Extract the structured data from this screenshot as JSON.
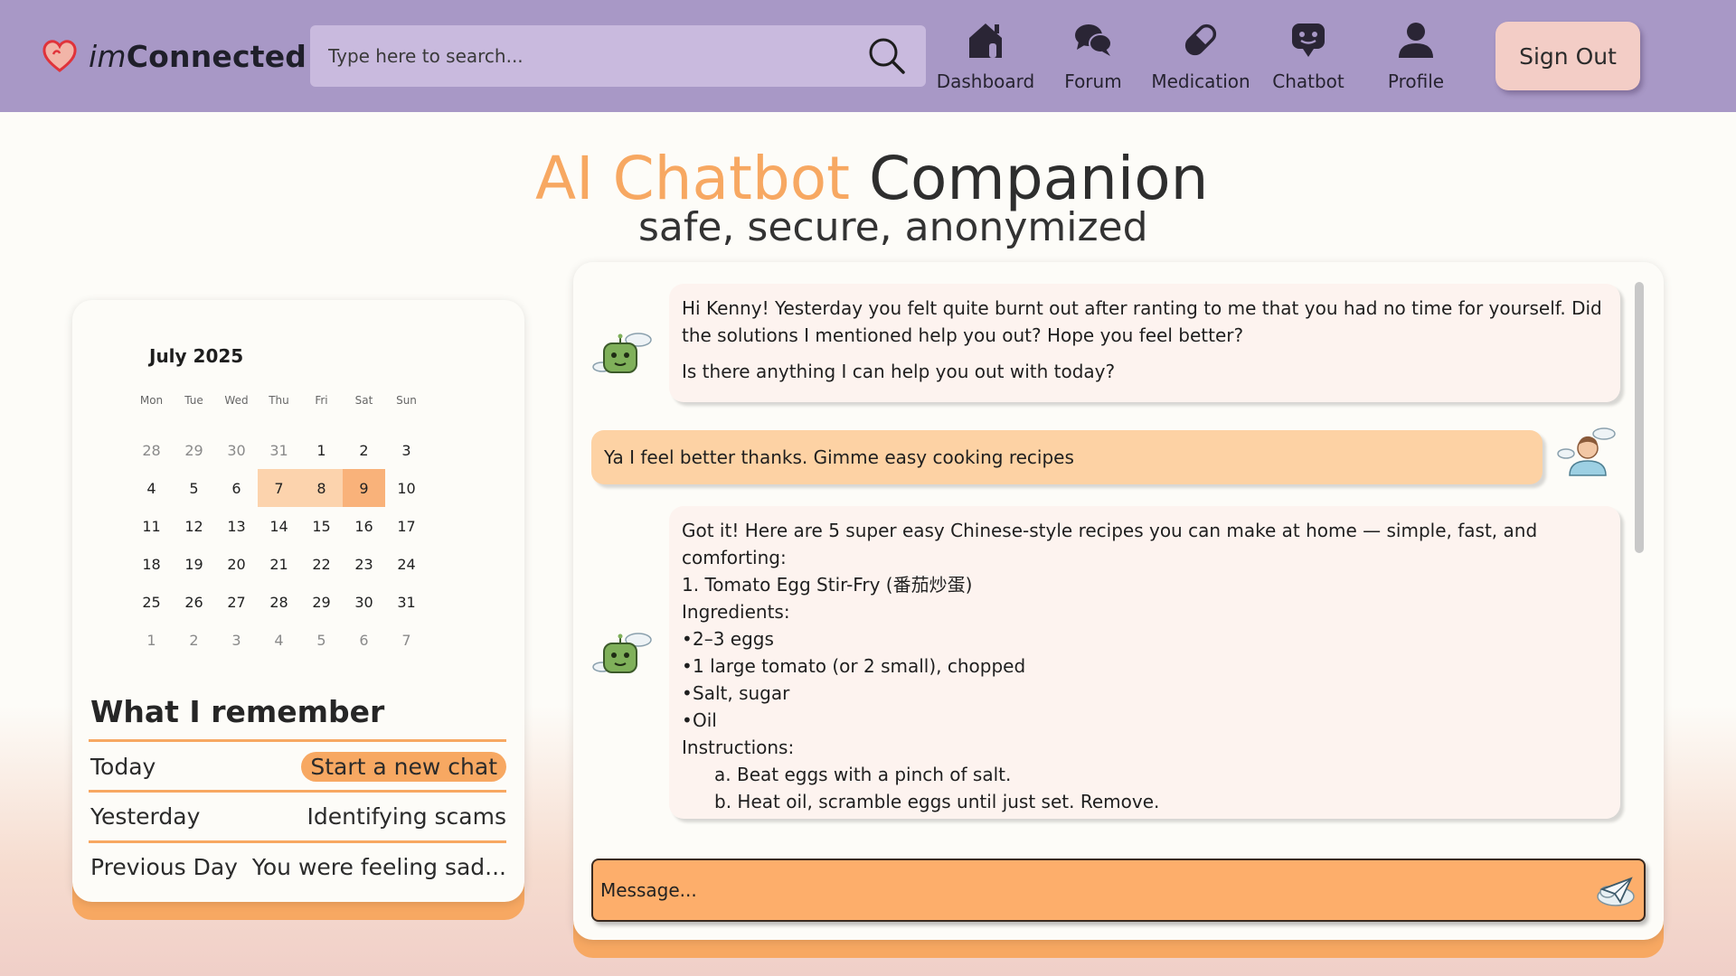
{
  "app": {
    "logo_im": "im",
    "logo_connected": "Connected"
  },
  "search": {
    "placeholder": "Type here to search..."
  },
  "nav": {
    "dashboard": "Dashboard",
    "forum": "Forum",
    "medication": "Medication",
    "chatbot": "Chatbot",
    "profile": "Profile",
    "sign_out": "Sign Out"
  },
  "title": {
    "accent": "AI Chatbot",
    "rest": " Companion",
    "subtitle": "safe, secure, anonymized"
  },
  "calendar": {
    "month": "July 2025",
    "weekdays": [
      "Mon",
      "Tue",
      "Wed",
      "Thu",
      "Fri",
      "Sat",
      "Sun"
    ],
    "weeks": [
      [
        "28",
        "29",
        "30",
        "31",
        "1",
        "2",
        "3"
      ],
      [
        "4",
        "5",
        "6",
        "7",
        "8",
        "9",
        "10"
      ],
      [
        "11",
        "12",
        "13",
        "14",
        "15",
        "16",
        "17"
      ],
      [
        "18",
        "19",
        "20",
        "21",
        "22",
        "23",
        "24"
      ],
      [
        "25",
        "26",
        "27",
        "28",
        "29",
        "30",
        "31"
      ],
      [
        "1",
        "2",
        "3",
        "4",
        "5",
        "6",
        "7"
      ]
    ],
    "highlighted": [
      "7",
      "8"
    ],
    "selected": "9"
  },
  "memory": {
    "title": "What I remember",
    "rows": [
      {
        "label": "Today",
        "value": "Start a new chat"
      },
      {
        "label": "Yesterday",
        "value": "Identifying scams"
      },
      {
        "label": "Previous Day",
        "value": "You were feeling sad..."
      }
    ]
  },
  "chat": {
    "messages": {
      "bot_1": "Hi Kenny! Yesterday you felt quite burnt out after ranting to me that you had no time for yourself. Did the solutions I mentioned help you out? Hope you feel better?",
      "bot_1b": "Is there anything I can help you out with today?",
      "user_1": "Ya I feel better thanks. Gimme easy cooking recipes",
      "bot_2_intro": "Got it! Here are 5 super easy Chinese-style recipes you can make at home — simple, fast, and comforting:",
      "bot_2_recipe": "1. Tomato Egg Stir-Fry (番茄炒蛋)",
      "bot_2_ing_label": "Ingredients:",
      "bot_2_ingredients": [
        "2–3 eggs",
        "1 large tomato (or 2 small), chopped",
        "Salt, sugar",
        "Oil"
      ],
      "bot_2_instr_label": "Instructions:",
      "bot_2_steps": [
        "a. Beat eggs with a pinch of salt.",
        "b. Heat oil, scramble eggs until just set. Remove."
      ]
    },
    "input_placeholder": "Message..."
  },
  "colors": {
    "nav_bg": "#a898c6",
    "accent_orange": "#f7a862",
    "signout_bg": "#f3cdc6"
  }
}
